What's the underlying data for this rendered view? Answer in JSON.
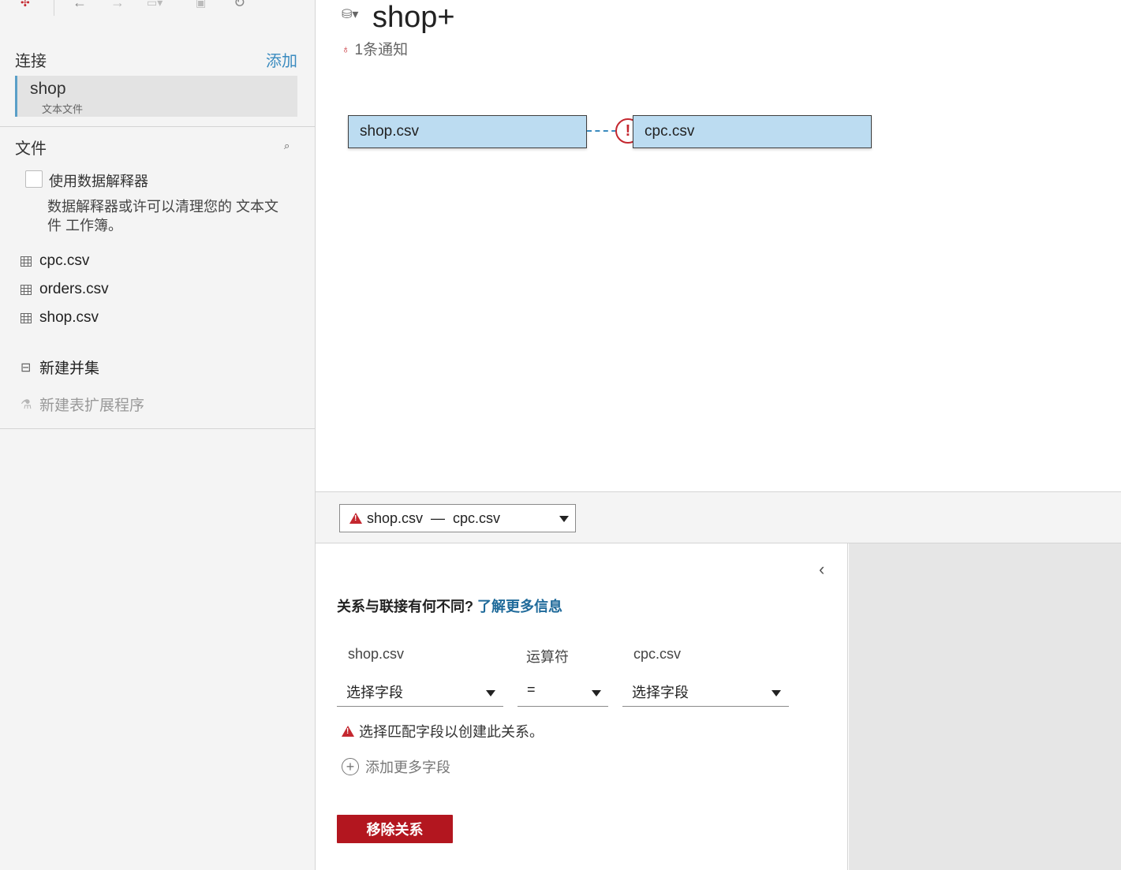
{
  "sidebar": {
    "connections_title": "连接",
    "add_label": "添加",
    "connection": {
      "name": "shop",
      "type": "文本文件"
    },
    "files_title": "文件",
    "interpreter_label": "使用数据解释器",
    "interpreter_desc": "数据解释器或许可以清理您的 文本文件 工作簿。",
    "files": [
      "cpc.csv",
      "orders.csv",
      "shop.csv"
    ],
    "new_union": "新建并集",
    "new_table_extension": "新建表扩展程序"
  },
  "canvas": {
    "datasource_title": "shop+",
    "notification": "1条通知",
    "left_table": "shop.csv",
    "right_table": "cpc.csv"
  },
  "relationship": {
    "selector": {
      "left": "shop.csv",
      "dash": "—",
      "right": "cpc.csv"
    },
    "help_text": "关系与联接有何不同?",
    "help_link": "了解更多信息",
    "left_col": "shop.csv",
    "operator_col": "运算符",
    "right_col": "cpc.csv",
    "left_field": "选择字段",
    "operator": "=",
    "right_field": "选择字段",
    "error": "选择匹配字段以创建此关系。",
    "add_more": "添加更多字段",
    "remove_button": "移除关系"
  },
  "colors": {
    "accent": "#3a8bbf",
    "danger": "#b3161f",
    "table_fill": "#bcdcf1"
  }
}
